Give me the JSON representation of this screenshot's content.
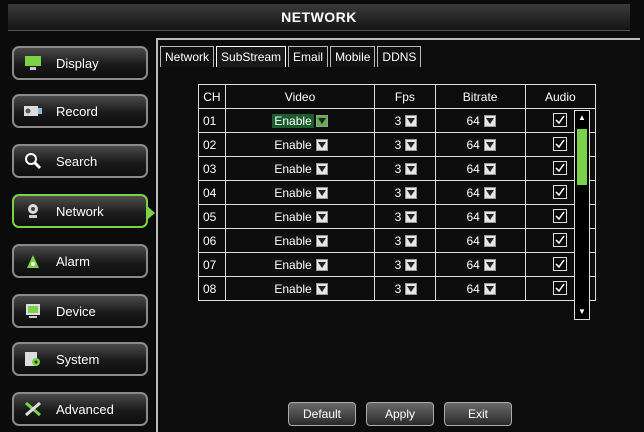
{
  "window": {
    "title": "NETWORK"
  },
  "sidebar": {
    "items": [
      {
        "label": "Display",
        "icon": "display-icon"
      },
      {
        "label": "Record",
        "icon": "record-icon"
      },
      {
        "label": "Search",
        "icon": "search-icon"
      },
      {
        "label": "Network",
        "icon": "network-icon"
      },
      {
        "label": "Alarm",
        "icon": "alarm-icon"
      },
      {
        "label": "Device",
        "icon": "device-icon"
      },
      {
        "label": "System",
        "icon": "system-icon"
      },
      {
        "label": "Advanced",
        "icon": "advanced-icon"
      }
    ]
  },
  "tabs": [
    "Network",
    "SubStream",
    "Email",
    "Mobile",
    "DDNS"
  ],
  "table": {
    "headers": [
      "CH",
      "Video",
      "Fps",
      "Bitrate",
      "Audio"
    ],
    "rows": [
      {
        "ch": "01",
        "video": "Enable",
        "fps": "3",
        "bitrate": "64",
        "audio": true
      },
      {
        "ch": "02",
        "video": "Enable",
        "fps": "3",
        "bitrate": "64",
        "audio": true
      },
      {
        "ch": "03",
        "video": "Enable",
        "fps": "3",
        "bitrate": "64",
        "audio": true
      },
      {
        "ch": "04",
        "video": "Enable",
        "fps": "3",
        "bitrate": "64",
        "audio": true
      },
      {
        "ch": "05",
        "video": "Enable",
        "fps": "3",
        "bitrate": "64",
        "audio": true
      },
      {
        "ch": "06",
        "video": "Enable",
        "fps": "3",
        "bitrate": "64",
        "audio": true
      },
      {
        "ch": "07",
        "video": "Enable",
        "fps": "3",
        "bitrate": "64",
        "audio": true
      },
      {
        "ch": "08",
        "video": "Enable",
        "fps": "3",
        "bitrate": "64",
        "audio": true
      }
    ]
  },
  "buttons": {
    "default": "Default",
    "apply": "Apply",
    "exit": "Exit"
  },
  "colors": {
    "accent": "#7ad14a"
  }
}
